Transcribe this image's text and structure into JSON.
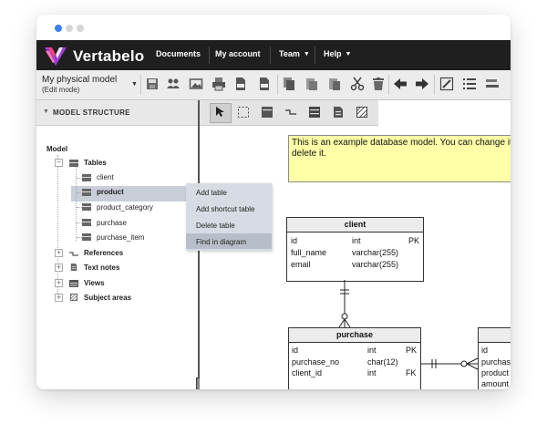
{
  "colors": {
    "active_dot": "#3b82f6",
    "navbar": "#1f1f1f",
    "note": "#ffffa8",
    "selection": "#c9ced9"
  },
  "app": {
    "brand": "Vertabelo"
  },
  "nav": {
    "documents": "Documents",
    "account": "My account",
    "team": "Team",
    "help": "Help"
  },
  "model": {
    "name": "My physical model",
    "mode": "(Edit mode)"
  },
  "toolbar_icons": [
    "save-icon",
    "users-icon",
    "image-icon",
    "print-icon",
    "sql-icon",
    "ddl-icon",
    "copy-icon",
    "paste-icon",
    "duplicate-icon",
    "cut-icon",
    "delete-icon",
    "undo-icon",
    "redo-icon",
    "edit-icon",
    "list-icon",
    "align-icon"
  ],
  "panel": {
    "title": "MODEL STRUCTURE",
    "root": "Model",
    "groups": {
      "tables": "Tables",
      "references": "References",
      "text_notes": "Text notes",
      "views": "Views",
      "subject_areas": "Subject areas"
    },
    "tables": [
      "client",
      "product",
      "product_category",
      "purchase",
      "purchase_item"
    ]
  },
  "context_menu": [
    "Add table",
    "Add shortcut table",
    "Delete table",
    "Find in diagram"
  ],
  "canvas_tools": [
    "select-icon",
    "area-select-icon",
    "table-tool-icon",
    "reference-tool-icon",
    "view-tool-icon",
    "note-tool-icon",
    "area-tool-icon"
  ],
  "note": "This is an example database model. You can change it or delete it.",
  "entities": {
    "client": {
      "name": "client",
      "columns": [
        {
          "name": "id",
          "type": "int",
          "key": "PK"
        },
        {
          "name": "full_name",
          "type": "varchar(255)",
          "key": ""
        },
        {
          "name": "email",
          "type": "varchar(255)",
          "key": ""
        }
      ]
    },
    "purchase": {
      "name": "purchase",
      "columns": [
        {
          "name": "id",
          "type": "int",
          "key": "PK"
        },
        {
          "name": "purchase_no",
          "type": "char(12)",
          "key": ""
        },
        {
          "name": "client_id",
          "type": "int",
          "key": "FK"
        }
      ]
    },
    "purchase_item": {
      "columns": [
        "id",
        "purchas",
        "product",
        "amount"
      ]
    }
  }
}
